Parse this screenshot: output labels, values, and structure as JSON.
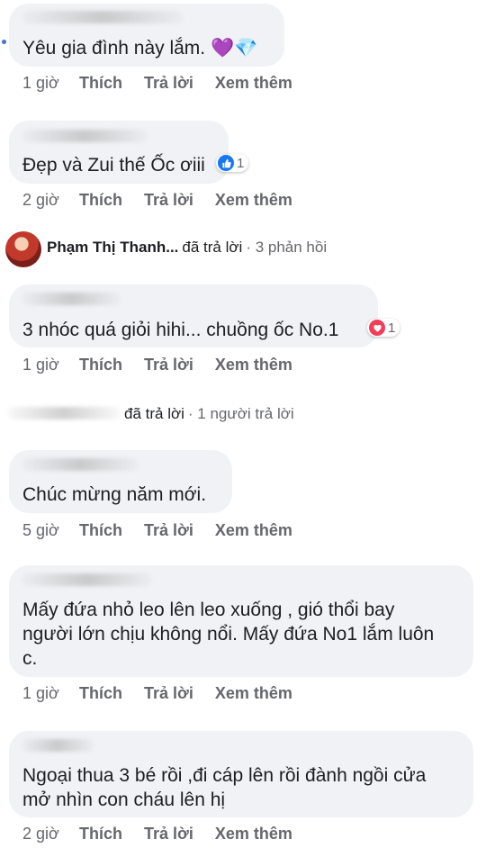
{
  "actions": {
    "like": "Thích",
    "reply": "Trả lời",
    "more": "Xem thêm"
  },
  "comments": [
    {
      "author": "Nguyen Phuong",
      "text": "Yêu gia đình này lắm. 💜💎",
      "time": "1 giờ"
    },
    {
      "author": "Pham Anh",
      "text": "Đẹp và Zui thế Ốc ơiii",
      "time": "2 giờ",
      "reaction": {
        "type": "like",
        "count": "1"
      }
    },
    {
      "author": "Sam Nguyen",
      "text": "3 nhóc quá giỏi hihi... chuồng ốc No.1",
      "time": "1 giờ",
      "reaction": {
        "type": "love",
        "count": "1"
      }
    },
    {
      "author": "",
      "text": "Chúc mừng năm mới.",
      "time": "5 giờ"
    },
    {
      "author": "Huynh Phuong",
      "text": "Mấy đứa nhỏ leo lên leo xuống , gió thổi bay người lớn chịu không nổi. Mấy đứa No1 lắm luôn c.",
      "time": "1 giờ"
    },
    {
      "author": "",
      "text": "Ngoại thua 3 bé rồi ,đi cáp lên rồi đành ngồi cửa mở nhìn con cháu lên hị",
      "time": "2 giờ"
    }
  ],
  "reply_threads": [
    {
      "name": "Phạm Thị Thanh...",
      "action": "đã trả lời",
      "count": "· 3 phản hồi"
    },
    {
      "name": "",
      "action": "đã trả lời",
      "count": "· 1 người trả lời"
    }
  ],
  "colors": {
    "bubble": "#f0f2f5",
    "meta": "#65676b",
    "like": "#1877f2",
    "love": "#f33e58"
  }
}
